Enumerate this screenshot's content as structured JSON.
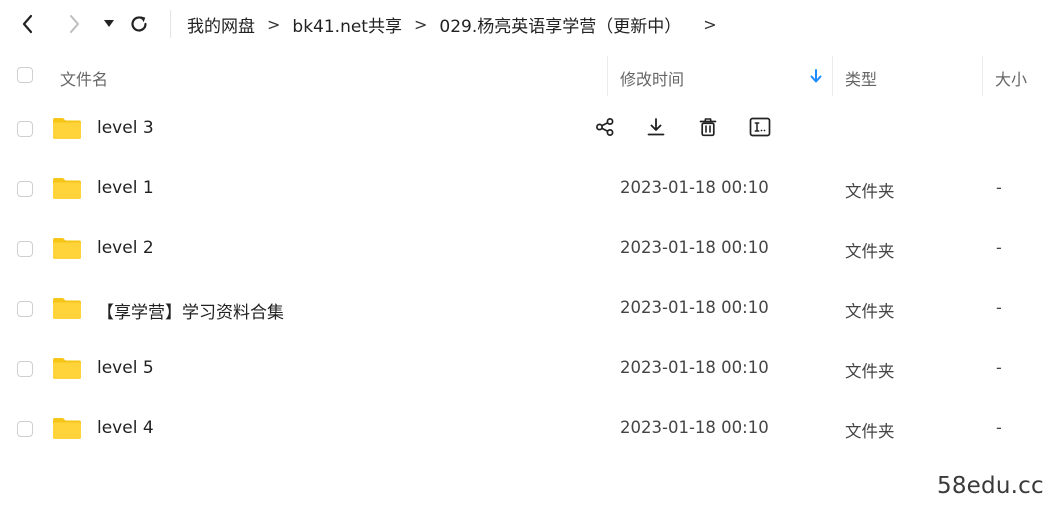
{
  "nav": {
    "back_icon": "chevron-left-icon",
    "forward_icon": "chevron-right-icon",
    "dropdown_icon": "caret-down-icon",
    "refresh_icon": "refresh-icon"
  },
  "breadcrumb": {
    "items": [
      "我的网盘",
      "bk41.net共享",
      "029.杨亮英语享学营（更新中）"
    ],
    "separator": ">",
    "tail": ">"
  },
  "table": {
    "headers": {
      "name": "文件名",
      "modified": "修改时间",
      "type": "类型",
      "size": "大小"
    },
    "sort_icon": "arrow-down-icon",
    "rows": [
      {
        "name": "level 3",
        "modified": "",
        "type": "",
        "size": "",
        "hovered": true
      },
      {
        "name": "level 1",
        "modified": "2023-01-18 00:10",
        "type": "文件夹",
        "size": "-"
      },
      {
        "name": "level 2",
        "modified": "2023-01-18 00:10",
        "type": "文件夹",
        "size": "-"
      },
      {
        "name": "【享学营】学习资料合集",
        "modified": "2023-01-18 00:10",
        "type": "文件夹",
        "size": "-"
      },
      {
        "name": "level 5",
        "modified": "2023-01-18 00:10",
        "type": "文件夹",
        "size": "-"
      },
      {
        "name": "level 4",
        "modified": "2023-01-18 00:10",
        "type": "文件夹",
        "size": "-"
      }
    ],
    "row_actions": [
      "share-icon",
      "download-icon",
      "delete-icon",
      "rename-icon"
    ]
  },
  "colors": {
    "folder": "#FFD43B",
    "folder_back": "#F5C518",
    "sort_arrow": "#1a8cff"
  },
  "watermark": "58edu.cc"
}
